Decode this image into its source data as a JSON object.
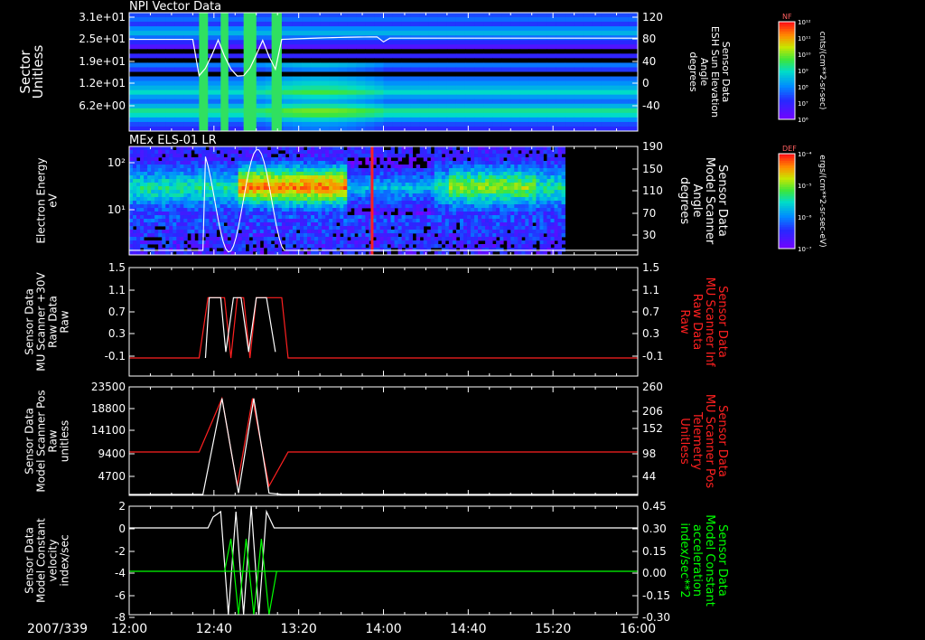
{
  "window": {
    "date_label": "2007/339"
  },
  "time_axis": {
    "ticks": [
      "12:00",
      "12:40",
      "13:20",
      "14:00",
      "14:40",
      "15:20",
      "16:00"
    ]
  },
  "colors": {
    "background": "#000000",
    "axis": "#ffffff",
    "red_series": "#ff2020",
    "green_series": "#00ff00",
    "white_series": "#ffffff"
  },
  "colorbars": [
    {
      "tag": "NF",
      "units": "cnts/(cm**2-sr-sec)",
      "ticks": [
        "10¹²",
        "10¹¹",
        "10¹⁰",
        "10⁹",
        "10⁸",
        "10⁷",
        "10⁶"
      ]
    },
    {
      "tag": "DEF",
      "units": "ergs/(cm**2-sr-sec-eV)",
      "ticks": [
        "10⁻⁴",
        "10⁻⁵",
        "10⁻⁶",
        "10⁻⁷"
      ]
    }
  ],
  "chart_data": [
    {
      "type": "heatmap",
      "title": "NPI Vector Data",
      "ylabel_lines": [
        "Sector",
        "Unitless"
      ],
      "y_ticks": [
        "3.1e+01",
        "2.5e+01",
        "1.9e+01",
        "1.2e+01",
        "6.2e+00"
      ],
      "y2label_lines": [
        "Sensor Data",
        "ESH Sun Elevation",
        "Angle",
        "degrees"
      ],
      "y2_ticks": [
        "120",
        "80",
        "40",
        "0",
        "-40"
      ],
      "y2lim": [
        -70,
        120
      ]
    },
    {
      "type": "heatmap",
      "title": "MEx ELS-01 LR",
      "ylabel_lines": [
        "Electron Energy",
        "eV"
      ],
      "y_ticks": [
        "10²",
        "10¹"
      ],
      "y2label_lines": [
        "Sensor Data",
        "Model Scanner",
        "Angle",
        "degrees"
      ],
      "y2_ticks": [
        "190",
        "150",
        "110",
        "70",
        "30"
      ],
      "y2lim": [
        0,
        190
      ]
    },
    {
      "type": "line",
      "ylabel_lines": [
        "Sensor Data",
        "MU Scanner +30V",
        "Raw Data",
        "Raw"
      ],
      "y_ticks": [
        "1.5",
        "1.1",
        "0.7",
        "0.3",
        "-0.1"
      ],
      "ylim": [
        -0.3,
        1.5
      ],
      "y2label_lines": [
        "Sensor Data",
        "MU Scanner Inf",
        "Raw Data",
        "Raw"
      ],
      "y2_ticks": [
        "1.5",
        "1.1",
        "0.7",
        "0.3",
        "-0.1"
      ],
      "y2lim": [
        -0.3,
        1.5
      ],
      "series": [
        {
          "color": "#ff2020",
          "x": [
            0,
            0.55,
            0.62,
            0.7,
            0.75,
            0.8,
            0.85,
            0.9,
            0.95,
            1.0,
            1.05,
            1.1,
            1.15,
            1.2,
            1.25,
            4.0
          ],
          "y": [
            0,
            0,
            1.0,
            1.0,
            1.0,
            0.0,
            1.0,
            1.0,
            0.0,
            1.0,
            1.0,
            1.0,
            1.0,
            1.0,
            0,
            0
          ]
        },
        {
          "color": "#ffffff",
          "x": [
            0.6,
            0.63,
            0.72,
            0.76,
            0.82,
            0.88,
            0.94,
            1.0,
            1.08,
            1.15
          ],
          "y": [
            0.0,
            1.0,
            1.0,
            0.1,
            1.0,
            1.0,
            0.1,
            1.0,
            1.0,
            0.1
          ]
        }
      ]
    },
    {
      "type": "line",
      "ylabel_lines": [
        "Sensor Data",
        "Model Scanner Pos",
        "Raw",
        "unitless"
      ],
      "y_ticks": [
        "23500",
        "18800",
        "14100",
        "9400",
        "4700"
      ],
      "ylim": [
        0,
        23500
      ],
      "y2label_lines": [
        "Sensor Data",
        "MU Scanner Pos",
        "Telemetry",
        "Unitless"
      ],
      "y2_ticks": [
        "260",
        "206",
        "152",
        "98",
        "44"
      ],
      "y2lim": [
        0,
        260
      ],
      "series": [
        {
          "color": "#ff2020",
          "x": [
            0,
            0.55,
            0.73,
            0.85,
            0.97,
            1.1,
            1.25,
            4.0
          ],
          "y": [
            9400,
            9400,
            21000,
            2000,
            21000,
            2000,
            9400,
            9400
          ]
        },
        {
          "color": "#ffffff",
          "x": [
            0,
            0.58,
            0.73,
            0.86,
            0.98,
            1.1,
            1.2,
            4.0
          ],
          "y": [
            200,
            200,
            21000,
            500,
            21000,
            500,
            200,
            200
          ]
        }
      ]
    },
    {
      "type": "line",
      "ylabel_lines": [
        "Sensor Data",
        "Model Constant",
        "velocity",
        "index/sec"
      ],
      "y_ticks": [
        "2",
        "0",
        "-2",
        "-4",
        "-6",
        "-8"
      ],
      "ylim": [
        -8,
        2
      ],
      "y2label_lines": [
        "Sensor Data",
        "Model Constant",
        "acceleration",
        "index/sec**2"
      ],
      "y2_ticks": [
        "0.45",
        "0.30",
        "0.15",
        "0.00",
        "-0.15",
        "-0.30"
      ],
      "y2lim": [
        -0.3,
        0.45
      ],
      "series": [
        {
          "color": "#ffffff",
          "x": [
            0,
            0.62,
            0.66,
            0.72,
            0.78,
            0.84,
            0.9,
            0.96,
            1.02,
            1.08,
            1.14,
            1.2,
            4.0
          ],
          "y": [
            0,
            0,
            1,
            1.5,
            -8,
            1.5,
            -8,
            2,
            -8,
            1.5,
            0,
            0,
            0
          ]
        },
        {
          "color": "#00ff00",
          "x": [
            0,
            4.0
          ],
          "y": [
            -4,
            -4
          ]
        },
        {
          "color": "#00ff00",
          "x": [
            0.75,
            0.8,
            0.86,
            0.92,
            0.98,
            1.04,
            1.1,
            1.16
          ],
          "y": [
            -4,
            -1,
            -8,
            -1,
            -8,
            -1,
            -8,
            -4
          ]
        }
      ]
    }
  ]
}
